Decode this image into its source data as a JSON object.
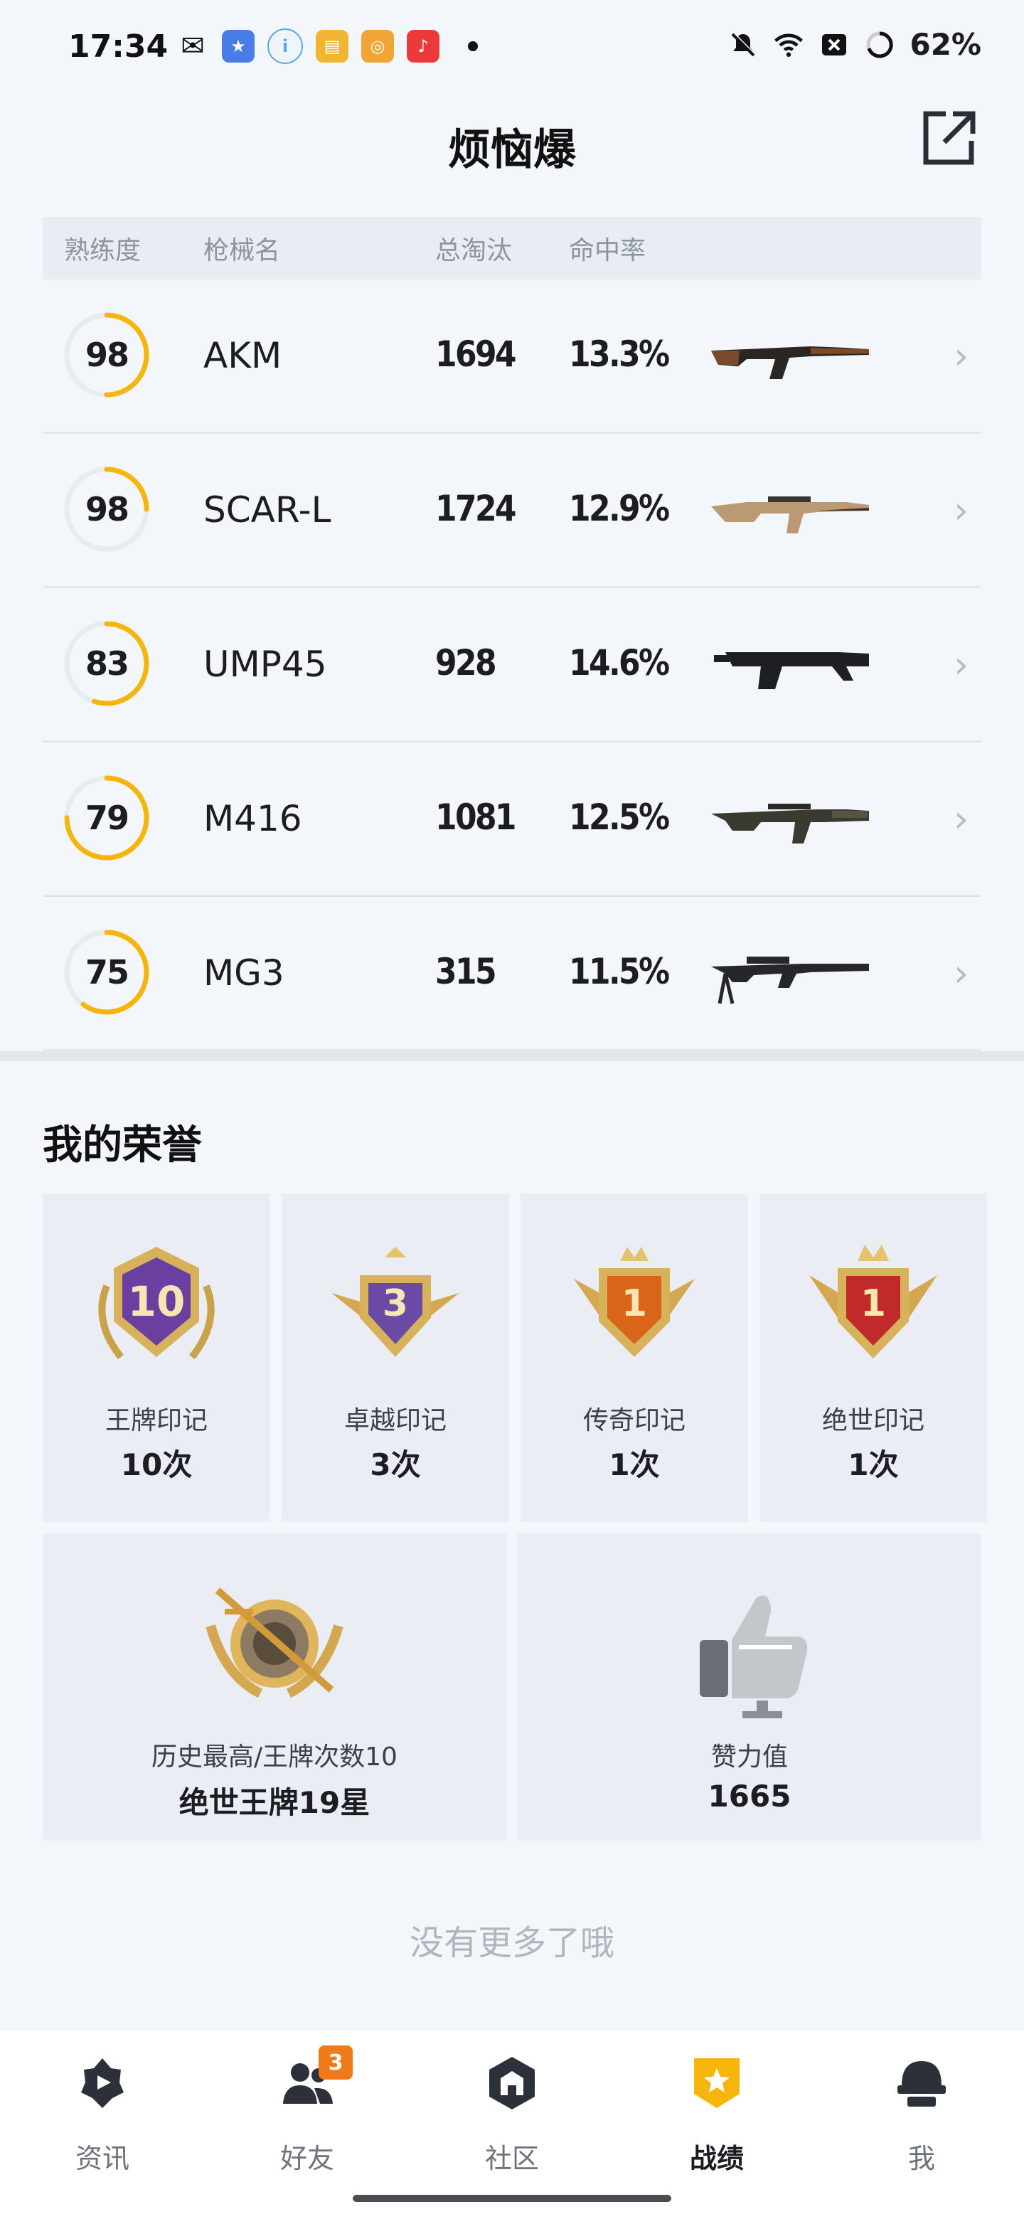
{
  "status_bar": {
    "time": "17:34",
    "battery": "62%",
    "app_icons": [
      {
        "name": "wechat-icon",
        "glyph": "✉",
        "color": "#111111"
      },
      {
        "name": "game-app-icon",
        "glyph": "★",
        "color": "#4a7ce8"
      },
      {
        "name": "ifly-icon",
        "glyph": "i",
        "color": "#5aa7e0"
      },
      {
        "name": "book-icon",
        "glyph": "▤",
        "color": "#f1b531"
      },
      {
        "name": "target-app-icon",
        "glyph": "◎",
        "color": "#f0a534"
      },
      {
        "name": "music-icon",
        "glyph": "♪",
        "color": "#ea3a3a"
      }
    ]
  },
  "header": {
    "title": "烦恼爆"
  },
  "table": {
    "headers": [
      "熟练度",
      "枪械名",
      "总淘汰",
      "命中率"
    ],
    "rows": [
      {
        "proficiency": "98",
        "name": "AKM",
        "kills": "1694",
        "hit_rate": "13.3%",
        "gun_icon": "akm-rifle-icon",
        "progress": 0.5
      },
      {
        "proficiency": "98",
        "name": "SCAR-L",
        "kills": "1724",
        "hit_rate": "12.9%",
        "gun_icon": "scar-l-rifle-icon",
        "progress": 0.25
      },
      {
        "proficiency": "83",
        "name": "UMP45",
        "kills": "928",
        "hit_rate": "14.6%",
        "gun_icon": "ump45-smg-icon",
        "progress": 0.55
      },
      {
        "proficiency": "79",
        "name": "M416",
        "kills": "1081",
        "hit_rate": "12.5%",
        "gun_icon": "m416-rifle-icon",
        "progress": 0.75
      },
      {
        "proficiency": "75",
        "name": "MG3",
        "kills": "315",
        "hit_rate": "11.5%",
        "gun_icon": "mg3-machinegun-icon",
        "progress": 0.6
      }
    ]
  },
  "honors": {
    "title": "我的荣誉",
    "items": [
      {
        "label": "王牌印记",
        "value": "10次",
        "badge_text": "10",
        "color": "#6a3fa0"
      },
      {
        "label": "卓越印记",
        "value": "3次",
        "badge_text": "3",
        "color": "#6b4aa6"
      },
      {
        "label": "传奇印记",
        "value": "1次",
        "badge_text": "1",
        "color": "#d9651a"
      },
      {
        "label": "绝世印记",
        "value": "1次",
        "badge_text": "1",
        "color": "#c02a2a"
      }
    ],
    "wide": [
      {
        "label": "历史最高/王牌次数10",
        "value": "绝世王牌19星",
        "icon": "rank-badge-icon"
      },
      {
        "label": "赞力值",
        "value": "1665",
        "icon": "thumbs-up-icon"
      }
    ]
  },
  "footer_text": "没有更多了哦",
  "bottom_nav": {
    "items": [
      {
        "label": "资讯",
        "icon": "news-icon",
        "active": false
      },
      {
        "label": "好友",
        "icon": "friends-icon",
        "active": false,
        "badge": "3"
      },
      {
        "label": "社区",
        "icon": "community-icon",
        "active": false
      },
      {
        "label": "战绩",
        "icon": "record-icon",
        "active": true
      },
      {
        "label": "我",
        "icon": "profile-icon",
        "active": false
      }
    ]
  },
  "colors": {
    "accent": "#f5b50a",
    "ring_track": "#e8ebef",
    "active_nav": "#f5b50a"
  }
}
